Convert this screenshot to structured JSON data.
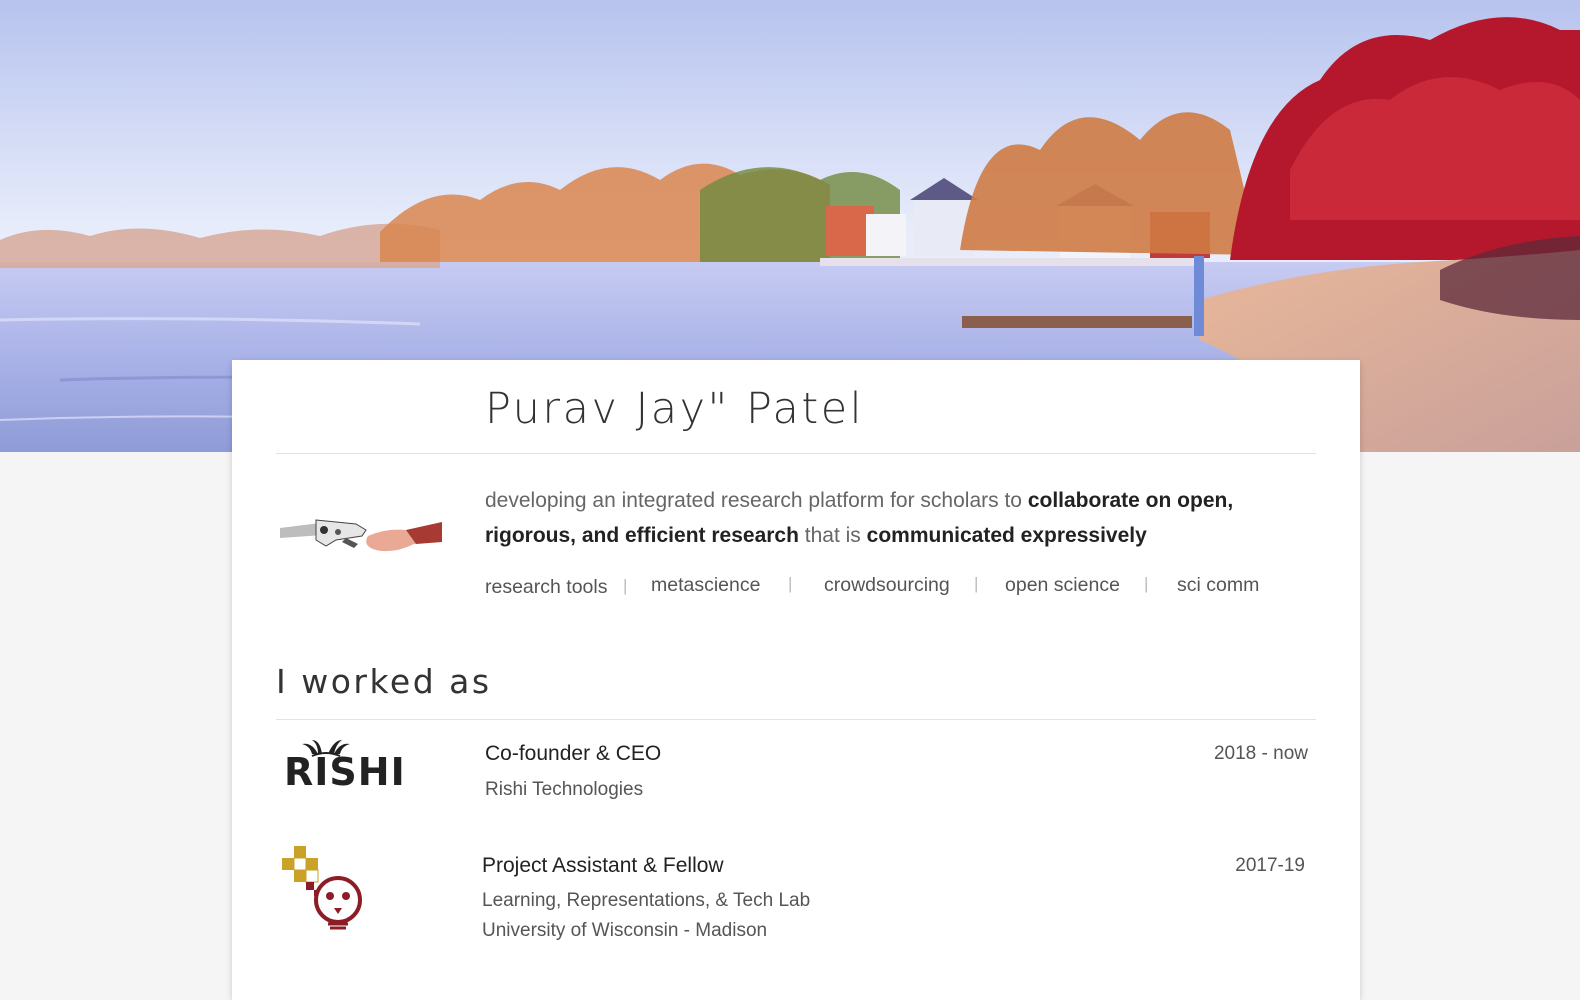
{
  "profile": {
    "name": "Purav Jay\" Patel",
    "tagline_parts": {
      "p1": "developing an integrated research platform for scholars to ",
      "b1": "collaborate on open, rigorous, and efficient research",
      "p2": " that is ",
      "b2": "communicated expressively"
    },
    "tags": [
      "research tools",
      "metascience",
      "crowdsourcing",
      "open science",
      "sci comm"
    ],
    "tag_separator": "|"
  },
  "experience": {
    "heading": "I worked as",
    "jobs": [
      {
        "title": "Co-founder & CEO",
        "org": "Rishi Technologies",
        "org2": "",
        "dates": "2018 - now",
        "logo_text": "RISHI"
      },
      {
        "title": "Project Assistant & Fellow",
        "org": "Learning, Representations, & Tech Lab",
        "org2": "University of Wisconsin - Madison",
        "dates": "2017-19",
        "logo_text": ""
      }
    ]
  },
  "colors": {
    "background": "#f5f5f5",
    "card": "#ffffff",
    "text": "#333333",
    "muted": "#666666",
    "lab_logo_red": "#8c1c26",
    "lab_logo_gold": "#c9a227"
  }
}
